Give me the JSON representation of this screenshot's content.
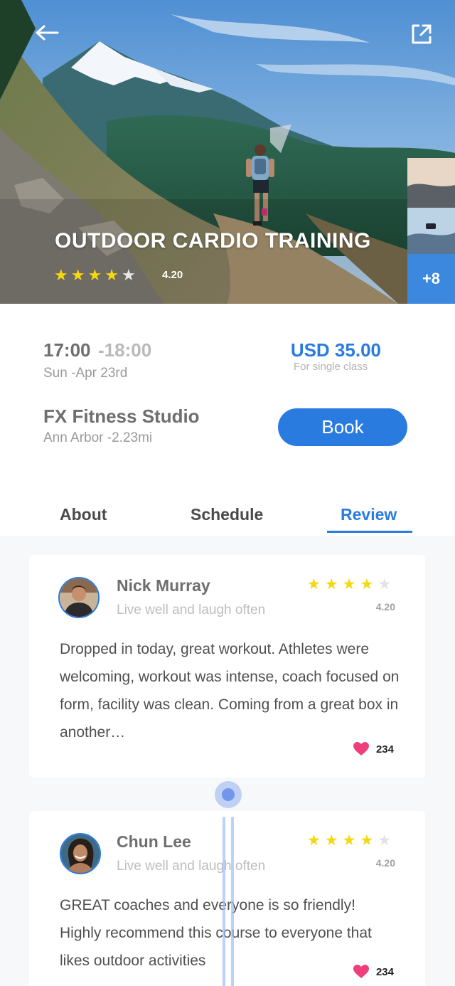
{
  "hero": {
    "title": "OUTDOOR CARDIO TRAINING",
    "rating": "4.20",
    "stars_filled": 4,
    "stars_total": 5,
    "more_photos": "+8"
  },
  "session": {
    "time_start": "17:00",
    "time_end": "-18:00",
    "date": "Sun -Apr 23rd",
    "price": "USD 35.00",
    "price_note": "For single class"
  },
  "studio": {
    "name": "FX Fitness Studio",
    "location": "Ann Arbor -2.23mi",
    "book_label": "Book"
  },
  "tabs": [
    {
      "label": "About"
    },
    {
      "label": "Schedule"
    },
    {
      "label": "Review",
      "active": true
    }
  ],
  "reviews": [
    {
      "name": "Nick Murray",
      "tagline": "Live well and laugh often",
      "rating": "4.20",
      "stars_filled": 4,
      "text": "Dropped in today, great workout. Athletes were welcoming, workout was intense, coach focused on form, facility was clean. Coming from a great box in another…",
      "likes": "234"
    },
    {
      "name": "Chun Lee",
      "tagline": "Live well and laugh often",
      "rating": "4.20",
      "stars_filled": 4,
      "text": "GREAT coaches and everyone is so friendly! Highly recommend this course to everyone that likes outdoor activities",
      "likes": "234"
    }
  ],
  "colors": {
    "accent": "#2a7be0",
    "star": "#f5d80f",
    "heart": "#ee3f7a"
  },
  "icons": [
    "back-arrow-icon",
    "share-external-icon",
    "star-icon",
    "heart-icon"
  ]
}
